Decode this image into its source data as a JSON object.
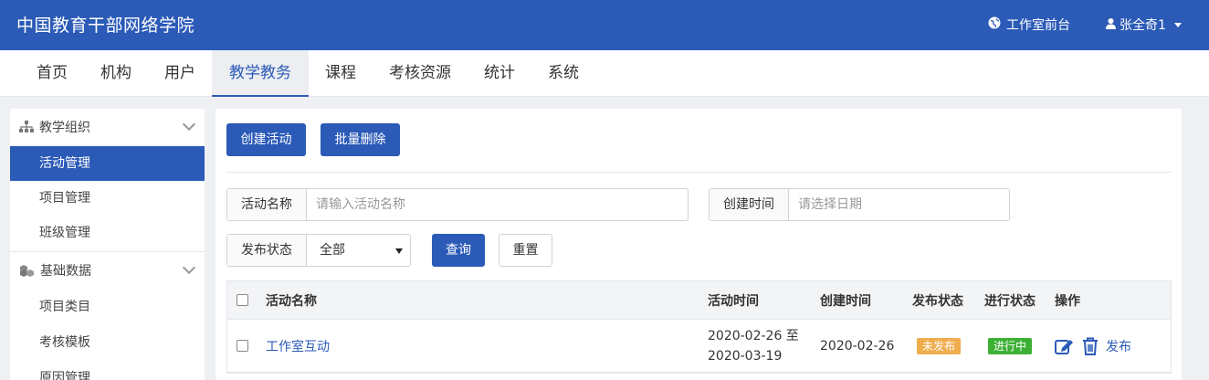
{
  "header": {
    "brand": "中国教育干部网络学院",
    "studio_link": "工作室前台",
    "user_name": "张全奇1"
  },
  "nav": {
    "items": [
      {
        "label": "首页"
      },
      {
        "label": "机构"
      },
      {
        "label": "用户"
      },
      {
        "label": "教学教务",
        "active": true
      },
      {
        "label": "课程"
      },
      {
        "label": "考核资源"
      },
      {
        "label": "统计"
      },
      {
        "label": "系统"
      }
    ]
  },
  "sidebar": {
    "group1": {
      "label": "教学组织",
      "icon": "org-tree-icon"
    },
    "group1_items": [
      {
        "label": "活动管理",
        "active": true
      },
      {
        "label": "项目管理"
      },
      {
        "label": "班级管理"
      }
    ],
    "group2": {
      "label": "基础数据",
      "icon": "cubes-icon"
    },
    "group2_items": [
      {
        "label": "项目类目"
      },
      {
        "label": "考核模板"
      },
      {
        "label": "原因管理"
      }
    ]
  },
  "toolbar": {
    "create_label": "创建活动",
    "batch_delete_label": "批量删除"
  },
  "filters": {
    "name_label": "活动名称",
    "name_placeholder": "请输入活动名称",
    "created_label": "创建时间",
    "created_placeholder": "请选择日期",
    "status_label": "发布状态",
    "status_value": "全部",
    "query_label": "查询",
    "reset_label": "重置"
  },
  "table": {
    "headers": {
      "name": "活动名称",
      "activity_time": "活动时间",
      "created_time": "创建时间",
      "publish_status": "发布状态",
      "progress_status": "进行状态",
      "actions": "操作"
    },
    "rows": [
      {
        "name": "工作室互动",
        "time_start": "2020-02-26 至",
        "time_end": "2020-03-19",
        "created": "2020-02-26",
        "publish_status": "未发布",
        "progress_status": "进行中",
        "publish_action": "发布"
      }
    ]
  },
  "colors": {
    "primary": "#2b5ab7",
    "unpublished": "#f0ad4e",
    "in_progress": "#3cb034"
  }
}
